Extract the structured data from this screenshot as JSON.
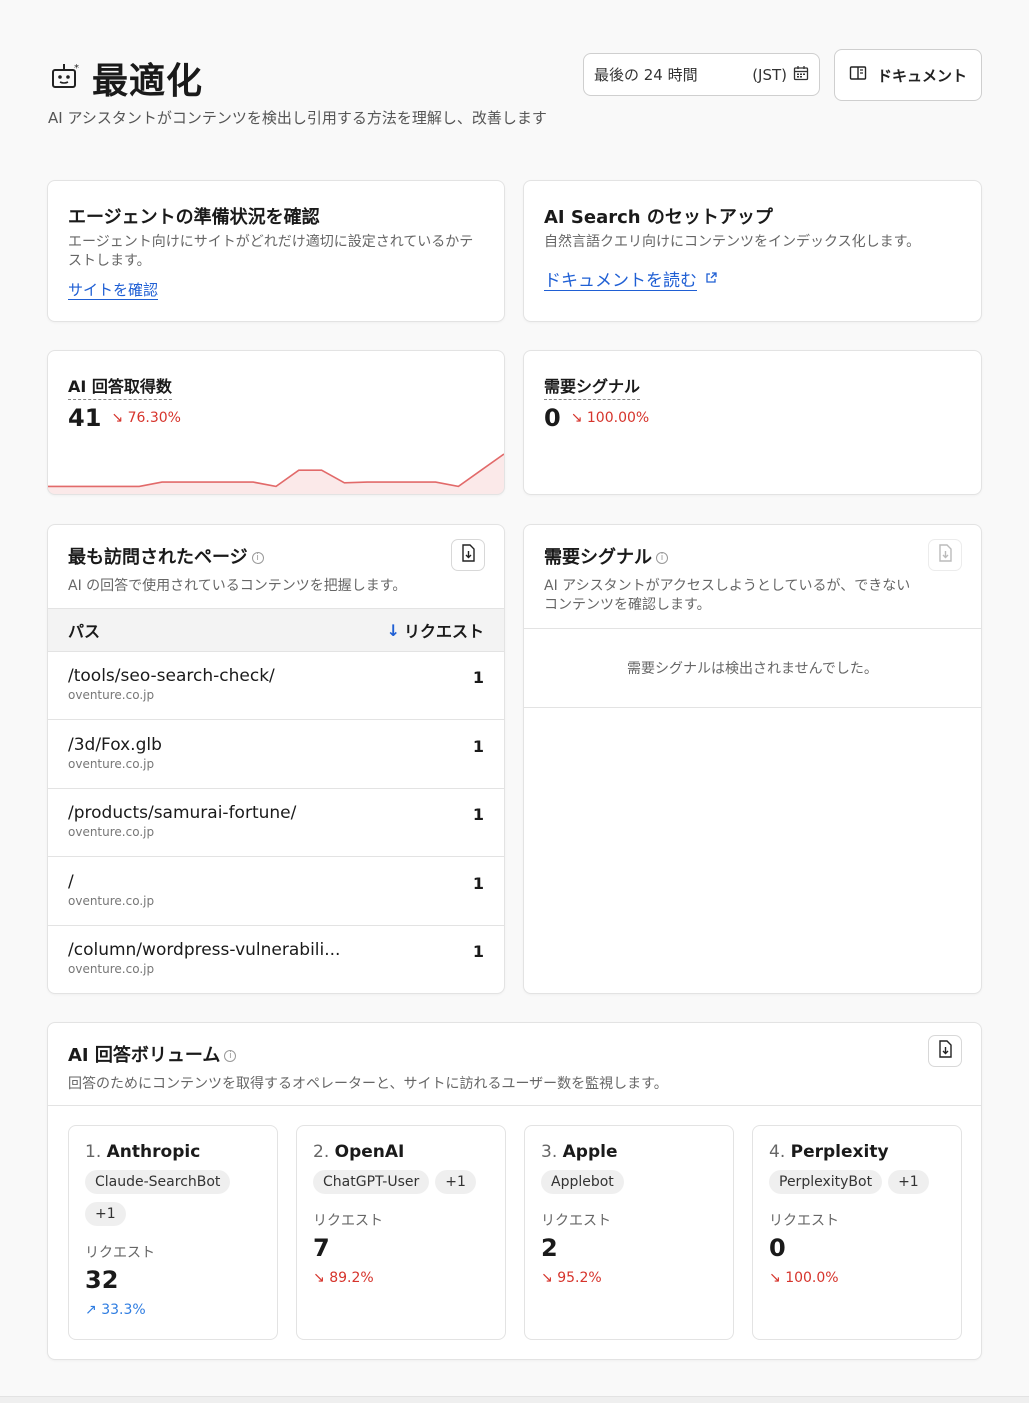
{
  "header": {
    "title": "最適化",
    "subtitle": "AI アシスタントがコンテンツを検出し引用する方法を理解し、改善します",
    "range_label": "最後の 24 時間",
    "range_tz": "(JST)",
    "docs_button": "ドキュメント"
  },
  "agent_card": {
    "title": "エージェントの準備状況を確認",
    "desc": "エージェント向けにサイトがどれだけ適切に設定されているかテストします。",
    "link": "サイトを確認"
  },
  "search_card": {
    "title": "AI Search のセットアップ",
    "desc": "自然言語クエリ向けにコンテンツをインデックス化します。",
    "link": "ドキュメントを読む"
  },
  "metrics": {
    "answers": {
      "label": "AI 回答取得数",
      "value": "41",
      "delta": "76.30%"
    },
    "demand": {
      "label": "需要シグナル",
      "value": "0",
      "delta": "100.00%"
    }
  },
  "top_pages": {
    "title": "最も訪問されたページ",
    "desc": "AI の回答で使用されているコンテンツを把握します。",
    "col_path": "パス",
    "col_requests": "リクエスト",
    "rows": [
      {
        "path": "/tools/seo-search-check/",
        "domain": "oventure.co.jp",
        "count": "1"
      },
      {
        "path": "/3d/Fox.glb",
        "domain": "oventure.co.jp",
        "count": "1"
      },
      {
        "path": "/products/samurai-fortune/",
        "domain": "oventure.co.jp",
        "count": "1"
      },
      {
        "path": "/",
        "domain": "oventure.co.jp",
        "count": "1"
      },
      {
        "path": "/column/wordpress-vulnerabili...",
        "domain": "oventure.co.jp",
        "count": "1"
      }
    ]
  },
  "demand_panel": {
    "title": "需要シグナル",
    "desc": "AI アシスタントがアクセスしようとしているが、できないコンテンツを確認します。",
    "empty": "需要シグナルは検出されませんでした。"
  },
  "volume": {
    "title": "AI 回答ボリューム",
    "desc": "回答のためにコンテンツを取得するオペレーターと、サイトに訪れるユーザー数を監視します。",
    "request_label": "リクエスト",
    "operators": [
      {
        "num": "1.",
        "name": "Anthropic",
        "chips": [
          "Claude-SearchBot",
          "+1"
        ],
        "value": "32",
        "delta": "33.3%",
        "trend": "up"
      },
      {
        "num": "2.",
        "name": "OpenAI",
        "chips": [
          "ChatGPT-User",
          "+1"
        ],
        "value": "7",
        "delta": "89.2%",
        "trend": "down"
      },
      {
        "num": "3.",
        "name": "Apple",
        "chips": [
          "Applebot"
        ],
        "value": "2",
        "delta": "95.2%",
        "trend": "down"
      },
      {
        "num": "4.",
        "name": "Perplexity",
        "chips": [
          "PerplexityBot",
          "+1"
        ],
        "value": "0",
        "delta": "100.0%",
        "trend": "down"
      }
    ]
  },
  "colors": {
    "accent": "#1f5fd4",
    "down": "#d6342c",
    "up": "#2f7de1",
    "sparkline": "#e26a6a"
  },
  "sparkline": [
    0.1,
    0.1,
    0.1,
    0.1,
    0.1,
    0.22,
    0.22,
    0.22,
    0.22,
    0.22,
    0.1,
    0.55,
    0.55,
    0.2,
    0.22,
    0.22,
    0.22,
    0.22,
    0.1,
    0.55,
    1.0
  ]
}
